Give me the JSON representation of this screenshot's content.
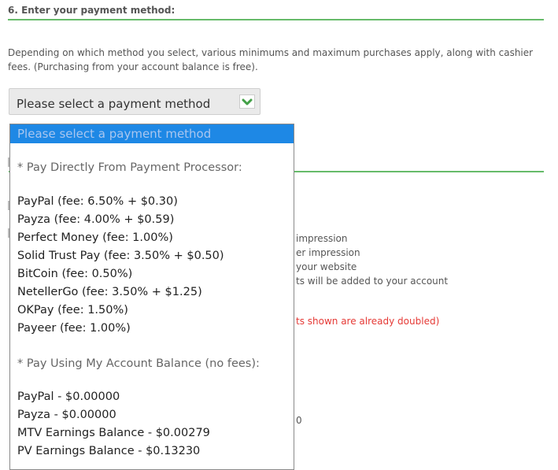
{
  "section": {
    "title": "6. Enter your payment method:",
    "description": "Depending on which method you select, various minimums and maximum purchases apply, along with cashier fees. (Purchasing from your account balance is free)."
  },
  "select": {
    "value": "Please select a payment method"
  },
  "dropdown": {
    "highlighted": "Please select a payment method",
    "groups": [
      {
        "label": "* Pay Directly From Payment Processor:",
        "options": [
          "PayPal (fee: 6.50% + $0.30)",
          "Payza (fee: 4.00% + $0.59)",
          "Perfect Money (fee: 1.00%)",
          "Solid Trust Pay (fee: 3.50% + $0.50)",
          "BitCoin (fee: 0.50%)",
          "NetellerGo (fee: 3.50% + $1.25)",
          "OKPay (fee: 1.50%)",
          "Payeer (fee: 1.00%)"
        ]
      },
      {
        "label": "* Pay Using My Account Balance (no fees):",
        "options": [
          "PayPal - $0.00000",
          "Payza - $0.00000",
          "MTV Earnings Balance - $0.00279",
          "PV Earnings Balance - $0.13230"
        ]
      }
    ]
  },
  "background": {
    "lines": [
      "impression",
      "er impression",
      "your website",
      "ts will be added to your account",
      "ts shown are already doubled)",
      "0"
    ]
  },
  "colors": {
    "accent_green": "#66bb6a",
    "highlight_blue": "#1e88e5",
    "check_green": "#43a047",
    "warning_red": "#e53935"
  }
}
